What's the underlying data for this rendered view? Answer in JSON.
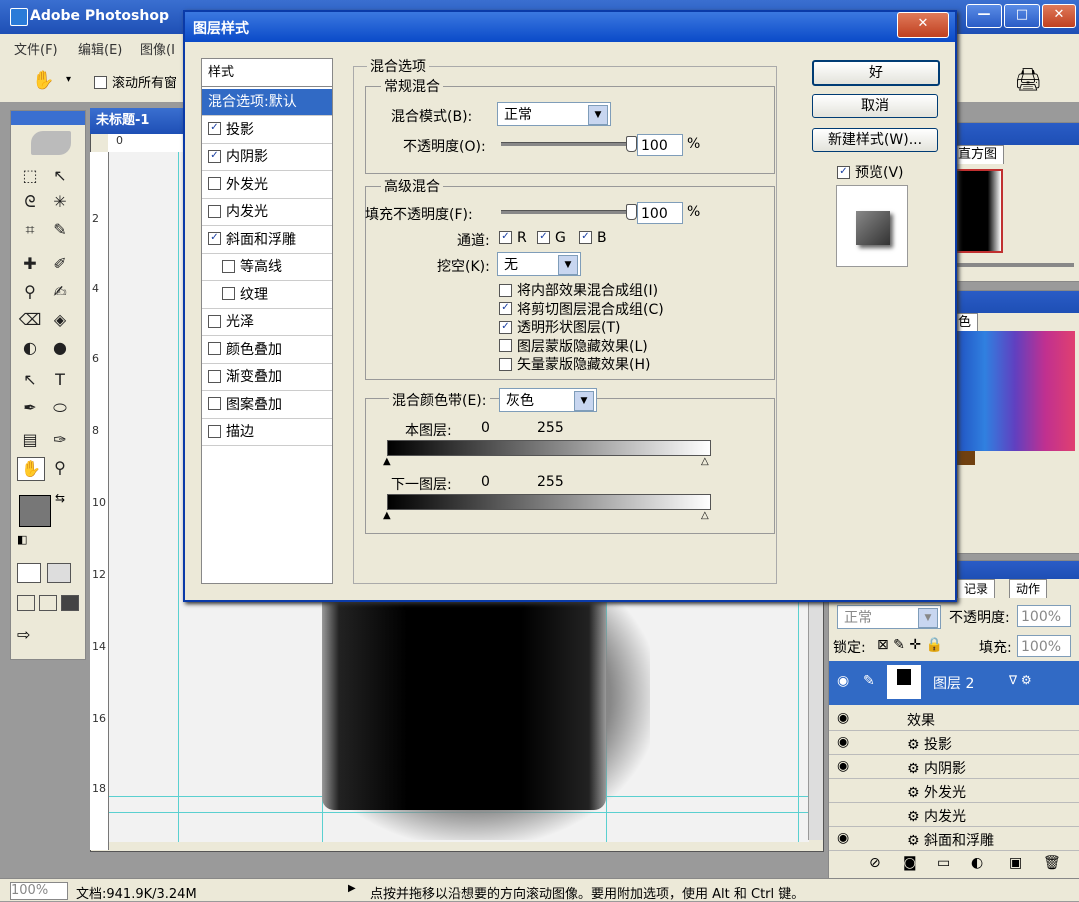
{
  "app": {
    "title": "Adobe Photoshop"
  },
  "menu": [
    "文件(F)",
    "编辑(E)",
    "图像(I"
  ],
  "options_bar": {
    "scroll_all_label": "滚动所有窗"
  },
  "document": {
    "title": "未标题-1"
  },
  "ruler_top": [
    "0"
  ],
  "ruler_left": [
    "2",
    "4",
    "6",
    "8",
    "10",
    "12",
    "14",
    "16",
    "18"
  ],
  "dialog": {
    "title": "图层样式",
    "styles_header": "样式",
    "styles": [
      {
        "label": "混合选项:默认",
        "checkbox": false,
        "checked": false,
        "selected": true,
        "indent": false
      },
      {
        "label": "投影",
        "checkbox": true,
        "checked": true,
        "selected": false,
        "indent": false
      },
      {
        "label": "内阴影",
        "checkbox": true,
        "checked": true,
        "selected": false,
        "indent": false
      },
      {
        "label": "外发光",
        "checkbox": true,
        "checked": false,
        "selected": false,
        "indent": false
      },
      {
        "label": "内发光",
        "checkbox": true,
        "checked": false,
        "selected": false,
        "indent": false
      },
      {
        "label": "斜面和浮雕",
        "checkbox": true,
        "checked": true,
        "selected": false,
        "indent": false
      },
      {
        "label": "等高线",
        "checkbox": true,
        "checked": false,
        "selected": false,
        "indent": true
      },
      {
        "label": "纹理",
        "checkbox": true,
        "checked": false,
        "selected": false,
        "indent": true
      },
      {
        "label": "光泽",
        "checkbox": true,
        "checked": false,
        "selected": false,
        "indent": false
      },
      {
        "label": "颜色叠加",
        "checkbox": true,
        "checked": false,
        "selected": false,
        "indent": false
      },
      {
        "label": "渐变叠加",
        "checkbox": true,
        "checked": false,
        "selected": false,
        "indent": false
      },
      {
        "label": "图案叠加",
        "checkbox": true,
        "checked": false,
        "selected": false,
        "indent": false
      },
      {
        "label": "描边",
        "checkbox": true,
        "checked": false,
        "selected": false,
        "indent": false
      }
    ],
    "blend_options_title": "混合选项",
    "general_blending": {
      "title": "常规混合",
      "mode_label": "混合模式(B):",
      "mode_value": "正常",
      "opacity_label": "不透明度(O):",
      "opacity_value": "100",
      "opacity_unit": "%",
      "opacity_fraction": 1.0
    },
    "advanced_blending": {
      "title": "高级混合",
      "fill_label": "填充不透明度(F):",
      "fill_value": "100",
      "fill_unit": "%",
      "fill_fraction": 1.0,
      "channels_label": "通道:",
      "channels": [
        {
          "label": "R",
          "checked": true
        },
        {
          "label": "G",
          "checked": true
        },
        {
          "label": "B",
          "checked": true
        }
      ],
      "knockout_label": "挖空(K):",
      "knockout_value": "无",
      "options": [
        {
          "label": "将内部效果混合成组(I)",
          "checked": false
        },
        {
          "label": "将剪切图层混合成组(C)",
          "checked": true
        },
        {
          "label": "透明形状图层(T)",
          "checked": true
        },
        {
          "label": "图层蒙版隐藏效果(L)",
          "checked": false
        },
        {
          "label": "矢量蒙版隐藏效果(H)",
          "checked": false
        }
      ]
    },
    "blend_if": {
      "label": "混合颜色带(E):",
      "value": "灰色",
      "this_layer_label": "本图层:",
      "this_low": "0",
      "this_high": "255",
      "underlying_label": "下一图层:",
      "under_low": "0",
      "under_high": "255"
    },
    "buttons": {
      "ok": "好",
      "cancel": "取消",
      "new_style": "新建样式(W)..."
    },
    "preview_label": "预览(V)",
    "preview_checked": true
  },
  "right_panels": {
    "histogram_tab": "直方图",
    "swatches_tab": "色",
    "layers_tabs": [
      "记录",
      "动作"
    ],
    "blend_mode": "正常",
    "opacity_label": "不透明度:",
    "opacity_value": "100%",
    "lock_label": "锁定:",
    "fill_label": "填充:",
    "fill_value": "100%",
    "layer_name": "图层 2",
    "effects_label": "效果",
    "effects": [
      "投影",
      "内阴影",
      "外发光",
      "内发光",
      "斜面和浮雕"
    ]
  },
  "status": {
    "zoom": "100%",
    "doc_info": "文档:941.9K/3.24M",
    "hint": "点按并拖移以沿想要的方向滚动图像。要用附加选项，使用 Alt 和 Ctrl 键。"
  },
  "colors": {
    "accent": "#316ac5",
    "titlebar": "#1e4fb5",
    "panel_bg": "#ece9d8"
  }
}
